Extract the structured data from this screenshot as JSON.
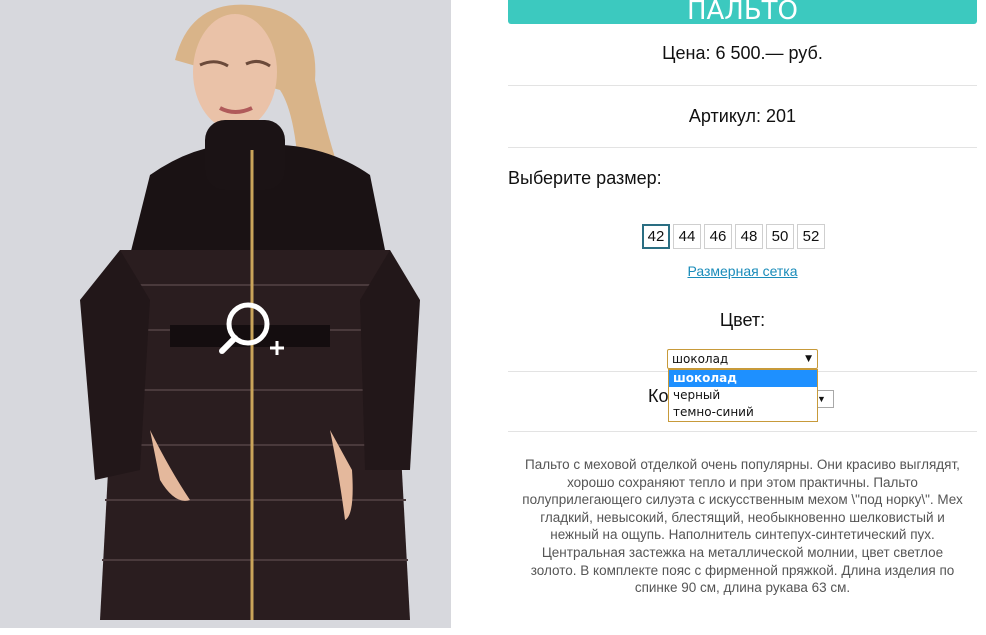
{
  "product": {
    "title": "ПАЛЬТО",
    "price": "Цена: 6 500.— руб.",
    "sku": "Артикул: 201",
    "choose_size": "Выберите размер:",
    "sizes": [
      "42",
      "44",
      "46",
      "48",
      "50",
      "52"
    ],
    "selected_size": "42",
    "size_chart_link": "Размерная сетка",
    "color_label": "Цвет:",
    "color_selected": "шоколад",
    "color_options": [
      "шоколад",
      "черный",
      "темно-синий"
    ],
    "qty_label_partial": "Ко",
    "description": "Пальто с меховой отделкой очень популярны. Они красиво выглядят, хорошо сохраняют тепло и при этом практичны. Пальто полуприлегающего силуэта с искусственным мехом \\\"под норку\\\". Мех гладкий, невысокий, блестящий, необыкновенно шелковистый и нежный на ощупь. Наполнитель синтепух-синтетический пух. Центральная застежка на металлической молнии, цвет светлое золото. В комплекте пояс с фирменной пряжкой. Длина изделия по спинке 90 см, длина рукава 63 см."
  },
  "colors": {
    "accent": "#3cc9bf",
    "link": "#1a8cba",
    "dropdown_highlight": "#1e90ff"
  },
  "icons": {
    "zoom": "zoom-in-magnifier-icon",
    "select_arrow": "triangle-down-icon"
  }
}
